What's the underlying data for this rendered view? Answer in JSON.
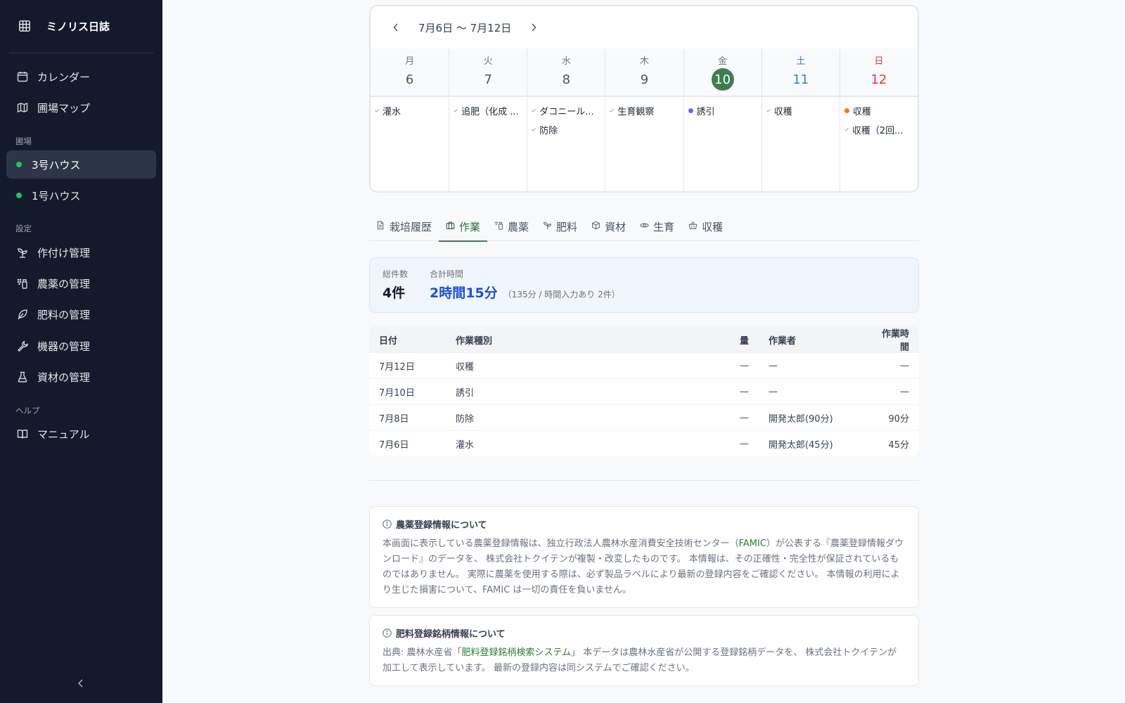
{
  "app": {
    "title": "ミノリス日誌"
  },
  "sidebar": {
    "nav": [
      {
        "label": "カレンダー",
        "icon": "calendar-icon"
      },
      {
        "label": "圃場マップ",
        "icon": "map-icon"
      }
    ],
    "fields_label": "圃場",
    "fields": [
      {
        "label": "3号ハウス",
        "active": true
      },
      {
        "label": "1号ハウス",
        "active": false
      }
    ],
    "settings_label": "設定",
    "settings": [
      {
        "label": "作付け管理",
        "icon": "sprout-icon"
      },
      {
        "label": "農薬の管理",
        "icon": "sprayer-icon"
      },
      {
        "label": "肥料の管理",
        "icon": "leaf-icon"
      },
      {
        "label": "機器の管理",
        "icon": "wrench-icon"
      },
      {
        "label": "資材の管理",
        "icon": "flask-icon"
      }
    ],
    "help_label": "ヘルプ",
    "help": [
      {
        "label": "マニュアル",
        "icon": "book-icon"
      }
    ]
  },
  "calendar": {
    "range_label": "7月6日 〜 7月12日",
    "days": [
      {
        "dow": "月",
        "num": "6",
        "events": [
          {
            "label": "灌水",
            "mark": "check"
          }
        ]
      },
      {
        "dow": "火",
        "num": "7",
        "events": [
          {
            "label": "追肥（化成 ...",
            "mark": "check"
          }
        ]
      },
      {
        "dow": "水",
        "num": "8",
        "events": [
          {
            "label": "ダコニール...",
            "mark": "check"
          },
          {
            "label": "防除",
            "mark": "check"
          }
        ]
      },
      {
        "dow": "木",
        "num": "9",
        "events": [
          {
            "label": "生育観察",
            "mark": "check"
          }
        ]
      },
      {
        "dow": "金",
        "num": "10",
        "today": true,
        "events": [
          {
            "label": "誘引",
            "mark": "dot",
            "color": "#6366f1"
          }
        ]
      },
      {
        "dow": "土",
        "num": "11",
        "events": [
          {
            "label": "収穫",
            "mark": "check"
          }
        ]
      },
      {
        "dow": "日",
        "num": "12",
        "events": [
          {
            "label": "収穫",
            "mark": "dot",
            "color": "#f97316"
          },
          {
            "label": "収穫（2回...",
            "mark": "check"
          }
        ]
      }
    ]
  },
  "tabs": [
    {
      "label": "栽培履歴",
      "icon": "document-icon"
    },
    {
      "label": "作業",
      "icon": "briefcase-icon",
      "active": true
    },
    {
      "label": "農薬",
      "icon": "sprayer-icon"
    },
    {
      "label": "肥料",
      "icon": "sprout-icon"
    },
    {
      "label": "資材",
      "icon": "box-icon"
    },
    {
      "label": "生育",
      "icon": "eye-icon"
    },
    {
      "label": "収穫",
      "icon": "basket-icon"
    }
  ],
  "summary": {
    "count_label": "総件数",
    "count_value": "4件",
    "time_label": "合計時間",
    "time_value": "2時間15分",
    "time_note": "（135分 / 時間入力あり 2件）"
  },
  "table": {
    "headers": {
      "date": "日付",
      "type": "作業種別",
      "qty": "量",
      "worker": "作業者",
      "time": "作業時間"
    },
    "rows": [
      {
        "date": "7月12日",
        "type": "収穫",
        "qty": "—",
        "worker": "—",
        "time": "—"
      },
      {
        "date": "7月10日",
        "type": "誘引",
        "qty": "—",
        "worker": "—",
        "time": "—"
      },
      {
        "date": "7月8日",
        "type": "防除",
        "qty": "—",
        "worker": "開発太郎(90分)",
        "time": "90分"
      },
      {
        "date": "7月6日",
        "type": "灌水",
        "qty": "—",
        "worker": "開発太郎(45分)",
        "time": "45分"
      }
    ]
  },
  "notices": {
    "pesticide": {
      "title": "農薬登録情報について",
      "before": "本画面に表示している農薬登録情報は、独立行政法人農林水産消費安全技術センター（",
      "link": "FAMIC",
      "after": "）が公表する『農薬登録情報ダウンロード』のデータを、 株式会社トクイテンが複製・改変したものです。 本情報は、その正確性・完全性が保証されているものではありません。 実際に農薬を使用する際は、必ず製品ラベルにより最新の登録内容をご確認ください。 本情報の利用により生じた損害について、FAMIC は一切の責任を負いません。"
    },
    "fertilizer": {
      "title": "肥料登録銘柄情報について",
      "before": "出典: 農林水産省「",
      "link": "肥料登録銘柄検索システム",
      "after": "」 本データは農林水産省が公開する登録銘柄データを、 株式会社トクイテンが加工して表示しています。 最新の登録内容は同システムでご確認ください。"
    }
  },
  "colors": {
    "accent_green": "#3f7d4f",
    "sidebar_bg": "#131a2b",
    "summary_blue": "#1d4fd8",
    "saturday": "#2f80d6",
    "sunday": "#e0374a"
  }
}
